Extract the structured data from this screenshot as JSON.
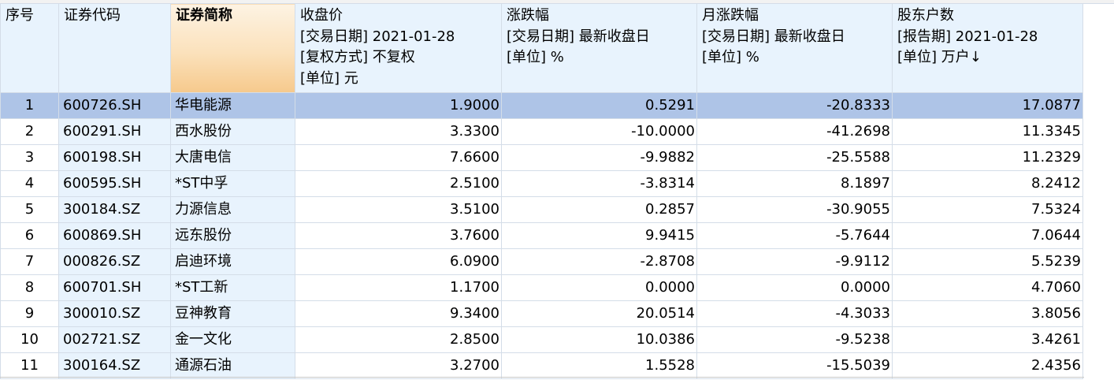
{
  "columns": [
    {
      "lines": [
        "序号"
      ]
    },
    {
      "lines": [
        "证券代码"
      ]
    },
    {
      "lines": [
        "证券简称"
      ]
    },
    {
      "lines": [
        "收盘价",
        "[交易日期] 2021-01-28",
        "[复权方式] 不复权",
        "[单位] 元"
      ]
    },
    {
      "lines": [
        "涨跌幅",
        "[交易日期] 最新收盘日",
        "[单位] %"
      ]
    },
    {
      "lines": [
        "月涨跌幅",
        "[交易日期] 最新收盘日",
        "[单位] %"
      ]
    },
    {
      "lines": [
        "股东户数",
        "[报告期] 2021-01-28",
        "[单位] 万户↓"
      ]
    }
  ],
  "rows": [
    [
      "1",
      "600726.SH",
      "华电能源",
      "1.9000",
      "0.5291",
      "-20.8333",
      "17.0877"
    ],
    [
      "2",
      "600291.SH",
      "西水股份",
      "3.3300",
      "-10.0000",
      "-41.2698",
      "11.3345"
    ],
    [
      "3",
      "600198.SH",
      "大唐电信",
      "7.6600",
      "-9.9882",
      "-25.5588",
      "11.2329"
    ],
    [
      "4",
      "600595.SH",
      "*ST中孚",
      "2.5100",
      "-3.8314",
      "8.1897",
      "8.2412"
    ],
    [
      "5",
      "300184.SZ",
      "力源信息",
      "3.5100",
      "0.2857",
      "-30.9055",
      "7.5324"
    ],
    [
      "6",
      "600869.SH",
      "远东股份",
      "3.7600",
      "9.9415",
      "-5.7644",
      "7.0644"
    ],
    [
      "7",
      "000826.SZ",
      "启迪环境",
      "6.0900",
      "-2.8708",
      "-9.9112",
      "5.5239"
    ],
    [
      "8",
      "600701.SH",
      "*ST工新",
      "1.1700",
      "0.0000",
      "0.0000",
      "4.7060"
    ],
    [
      "9",
      "300010.SZ",
      "豆神教育",
      "9.3400",
      "20.0514",
      "-4.3033",
      "3.8056"
    ],
    [
      "10",
      "002721.SZ",
      "金一文化",
      "2.8500",
      "10.0386",
      "-9.5238",
      "3.4261"
    ],
    [
      "11",
      "300164.SZ",
      "通源石油",
      "3.2700",
      "1.5528",
      "-15.5039",
      "2.4356"
    ]
  ],
  "selected_row": "1",
  "sorted_column": "证券简称",
  "colors": {
    "header_bg": "#e8f3fd",
    "selected_row_bg": "#aec4e7",
    "sorted_header_bg": "#f6c98c",
    "grid_line": "#d4dde8"
  }
}
